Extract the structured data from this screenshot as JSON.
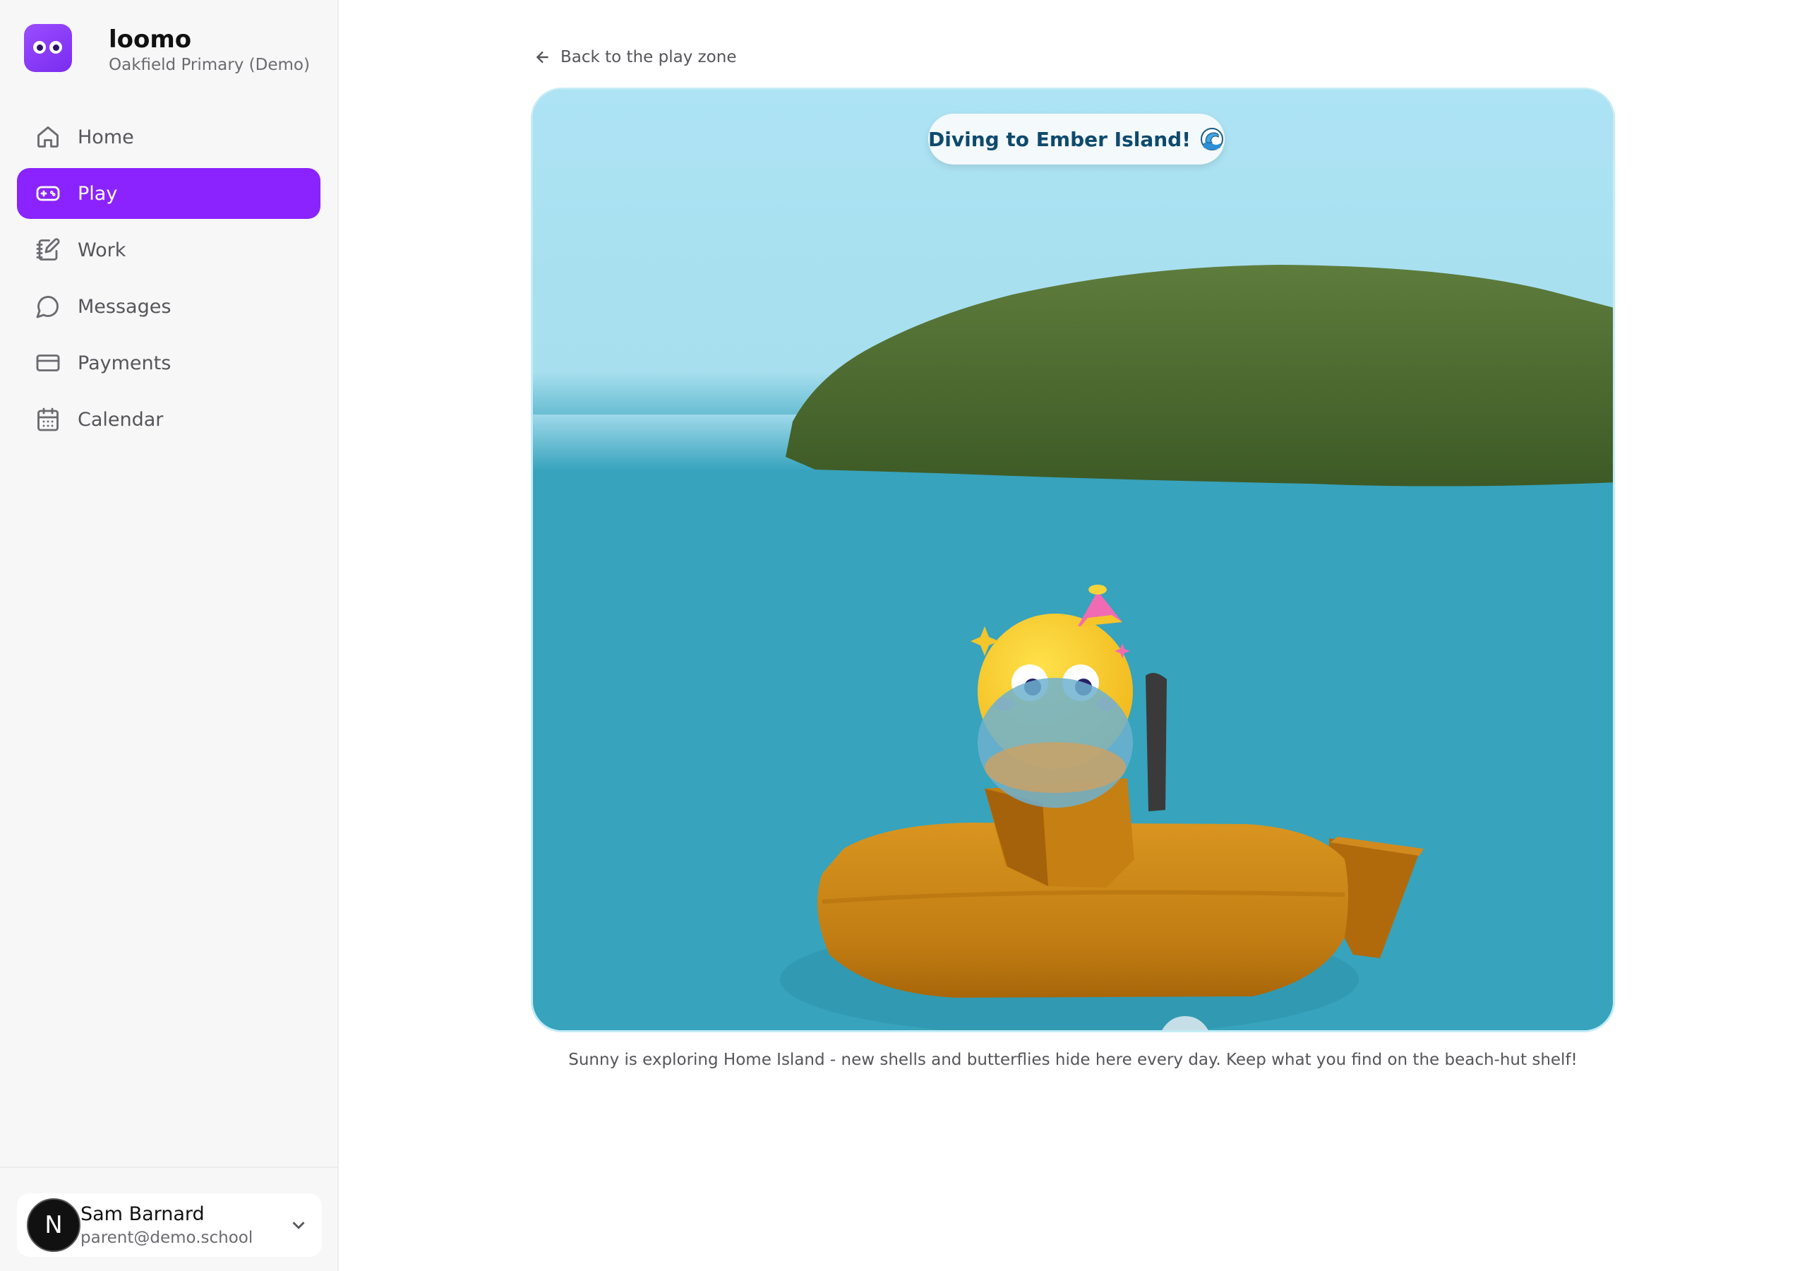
{
  "brand": {
    "name": "loomo",
    "school": "Oakfield Primary (Demo)"
  },
  "nav": {
    "items": [
      {
        "label": "Home",
        "icon": "home-icon",
        "active": false
      },
      {
        "label": "Play",
        "icon": "gamepad-icon",
        "active": true
      },
      {
        "label": "Work",
        "icon": "notebook-pen-icon",
        "active": false
      },
      {
        "label": "Messages",
        "icon": "message-circle-icon",
        "active": false
      },
      {
        "label": "Payments",
        "icon": "credit-card-icon",
        "active": false
      },
      {
        "label": "Calendar",
        "icon": "calendar-icon",
        "active": false
      }
    ]
  },
  "user": {
    "initial": "N",
    "name": "Sam Barnard",
    "email": "parent@demo.school"
  },
  "main": {
    "back_label": "Back to the play zone",
    "scene_status": "Diving to Ember Island!",
    "scene_status_icon": "wave-icon",
    "caption": "Sunny is exploring Home Island - new shells and butterflies hide here every day. Keep what you find on the beach-hut shelf!"
  },
  "colors": {
    "accent": "#8a23ff",
    "sky": "#aee2f3",
    "sea": "#37a3bd",
    "island": "#5a7a3a",
    "submarine": "#d18a1e",
    "character": "#f5c52a"
  }
}
